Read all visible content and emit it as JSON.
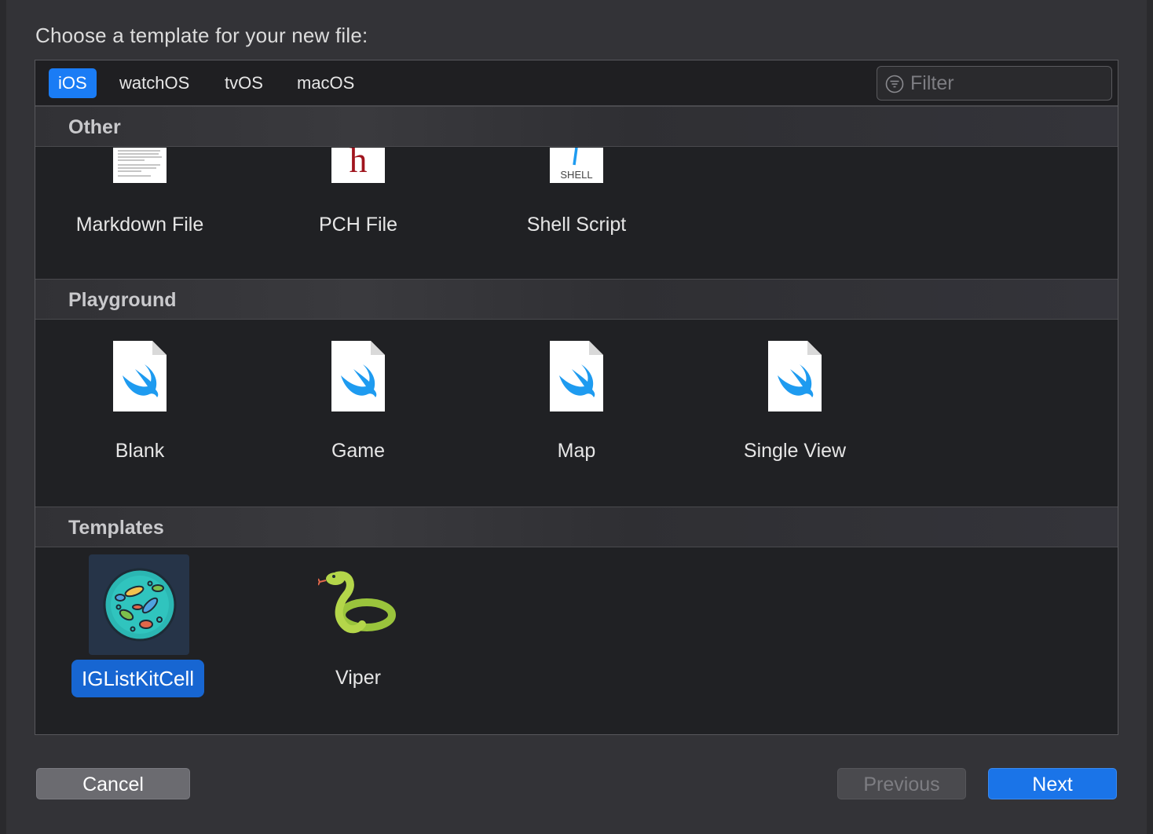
{
  "dialog": {
    "title": "Choose a template for your new file:"
  },
  "platform_tabs": [
    {
      "label": "iOS",
      "selected": true
    },
    {
      "label": "watchOS",
      "selected": false
    },
    {
      "label": "tvOS",
      "selected": false
    },
    {
      "label": "macOS",
      "selected": false
    }
  ],
  "filter": {
    "placeholder": "Filter",
    "value": ""
  },
  "sections": {
    "other": {
      "title": "Other",
      "items": [
        {
          "label": "Markdown File",
          "icon": "markdown-file-icon"
        },
        {
          "label": "PCH File",
          "icon": "pch-file-icon",
          "glyph": "h"
        },
        {
          "label": "Shell Script",
          "icon": "shell-script-icon",
          "glyph": "SHELL"
        }
      ]
    },
    "playground": {
      "title": "Playground",
      "items": [
        {
          "label": "Blank",
          "icon": "swift-file-icon"
        },
        {
          "label": "Game",
          "icon": "swift-file-icon"
        },
        {
          "label": "Map",
          "icon": "swift-file-icon"
        },
        {
          "label": "Single View",
          "icon": "swift-file-icon"
        }
      ]
    },
    "templates": {
      "title": "Templates",
      "items": [
        {
          "label": "IGListKitCell",
          "icon": "bacteria-icon",
          "selected": true
        },
        {
          "label": "Viper",
          "icon": "snake-icon",
          "selected": false
        }
      ]
    }
  },
  "footer": {
    "cancel_label": "Cancel",
    "previous_label": "Previous",
    "previous_enabled": false,
    "next_label": "Next"
  },
  "colors": {
    "accent": "#1a7cf5",
    "selection": "#1766d2",
    "swift": "#1e9bf0",
    "pch_red": "#a0151e"
  }
}
